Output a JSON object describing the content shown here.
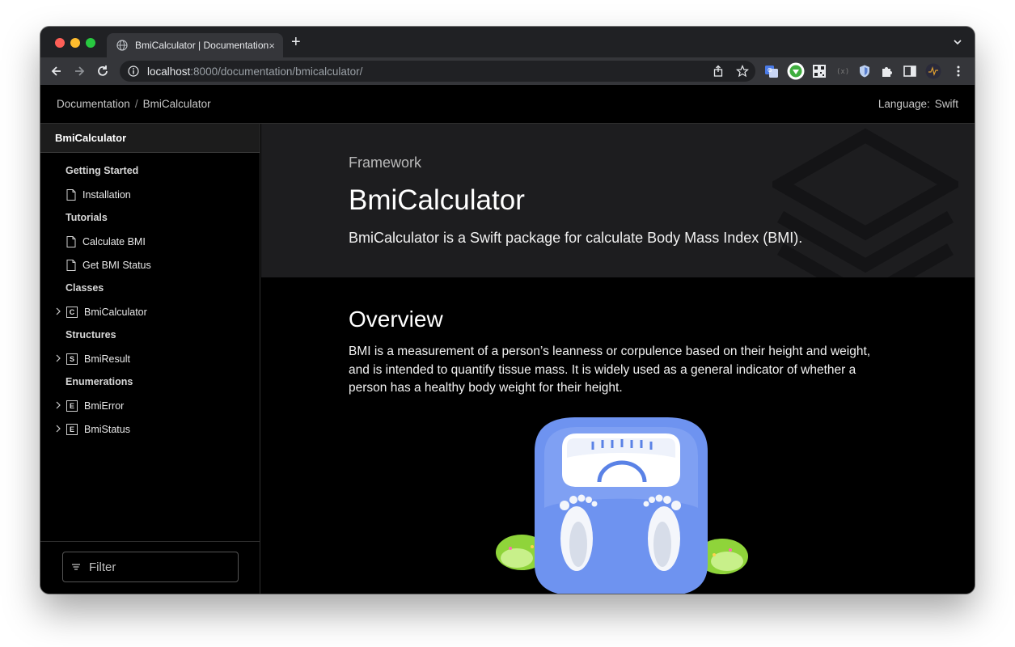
{
  "browser": {
    "tab_title": "BmiCalculator | Documentation",
    "tab_close": "×",
    "new_tab": "+",
    "url_host": "localhost",
    "url_path": ":8000/documentation/bmicalculator/"
  },
  "topnav": {
    "crumb_1": "Documentation",
    "crumb_sep": "/",
    "crumb_2": "BmiCalculator",
    "language_label": "Language:",
    "language_value": "Swift"
  },
  "sidebar": {
    "title": "BmiCalculator",
    "groups": [
      {
        "label": "Getting Started",
        "items": [
          {
            "label": "Installation",
            "icon": "doc-icon"
          }
        ]
      },
      {
        "label": "Tutorials",
        "items": [
          {
            "label": "Calculate BMI",
            "icon": "doc-icon"
          },
          {
            "label": "Get BMI Status",
            "icon": "doc-icon"
          }
        ]
      },
      {
        "label": "Classes",
        "items": [
          {
            "label": "BmiCalculator",
            "badge": "C"
          }
        ]
      },
      {
        "label": "Structures",
        "items": [
          {
            "label": "BmiResult",
            "badge": "S"
          }
        ]
      },
      {
        "label": "Enumerations",
        "items": [
          {
            "label": "BmiError",
            "badge": "E"
          },
          {
            "label": "BmiStatus",
            "badge": "E"
          }
        ]
      }
    ],
    "filter_placeholder": "Filter"
  },
  "hero": {
    "kicker": "Framework",
    "title": "BmiCalculator",
    "abstract": "BmiCalculator is a Swift package for calculate Body Mass Index (BMI)."
  },
  "overview": {
    "heading": "Overview",
    "paragraph": "BMI is a measurement of a person’s leanness or corpulence based on their height and weight, and is intended to quantify tissue mass. It is widely used as a general indicator of whether a person has a healthy body weight for their height."
  },
  "colors": {
    "page_bg": "#000000",
    "hero_bg": "#1d1d1f",
    "scale_blue": "#6e93f0",
    "grass_green": "#8fd43a"
  }
}
